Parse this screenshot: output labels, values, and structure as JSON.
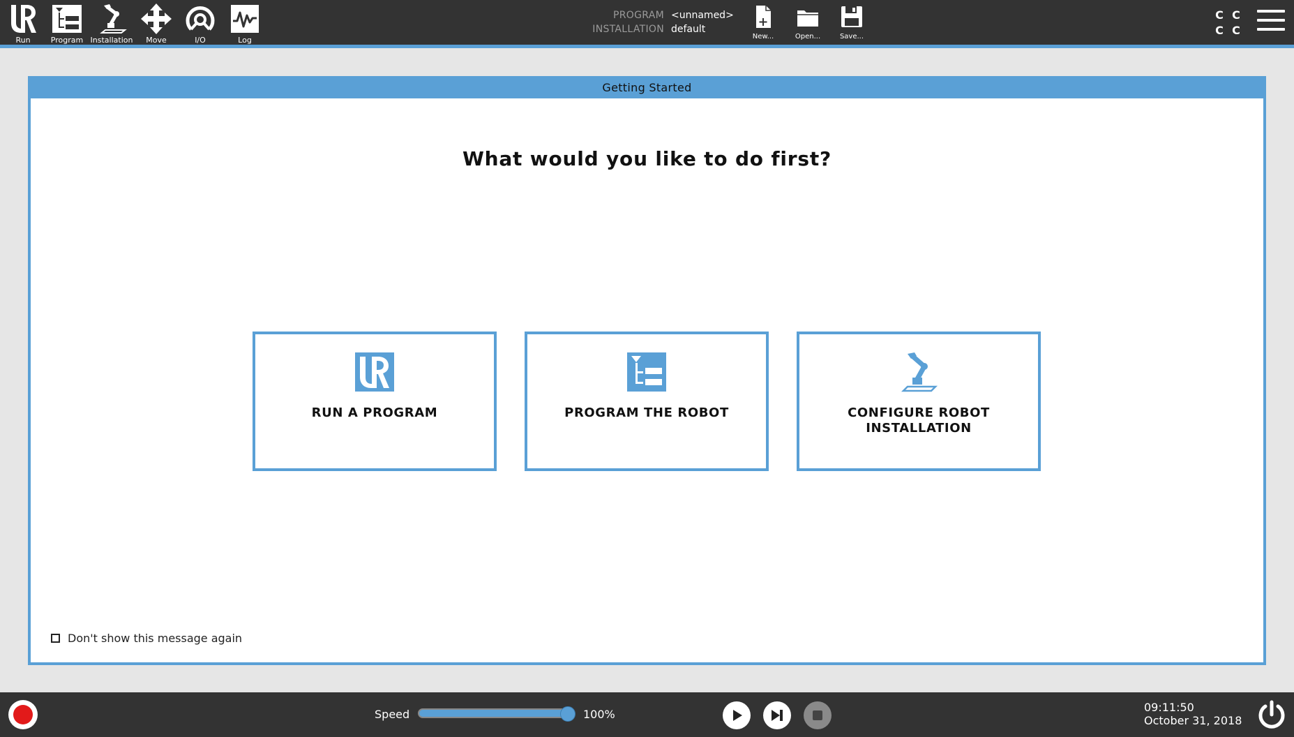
{
  "nav": {
    "run": "Run",
    "program": "Program",
    "installation": "Installation",
    "move": "Move",
    "io": "I/O",
    "log": "Log"
  },
  "program_info": {
    "program_key": "PROGRAM",
    "program_value": "<unnamed>",
    "installation_key": "INSTALLATION",
    "installation_value": "default"
  },
  "file": {
    "new": "New...",
    "open": "Open...",
    "save": "Save..."
  },
  "status_letters": [
    "C",
    "C",
    "C",
    "C"
  ],
  "dialog": {
    "title": "Getting Started",
    "question": "What would you like to do first?",
    "options": [
      {
        "label": "RUN A PROGRAM",
        "icon": "ur-logo-icon"
      },
      {
        "label": "PROGRAM THE ROBOT",
        "icon": "program-tree-icon"
      },
      {
        "label": "CONFIGURE ROBOT INSTALLATION",
        "icon": "robot-arm-icon"
      }
    ],
    "dont_show": "Don't show this message again",
    "dont_show_checked": false
  },
  "bottom": {
    "speed_label": "Speed",
    "speed_value": "100%",
    "speed_fraction": 1.0,
    "time": "09:11:50",
    "date": "October 31, 2018"
  },
  "colors": {
    "accent": "#5aa0d6",
    "bar": "#333333",
    "background": "#e6e6e6",
    "estop": "#e21a1a"
  }
}
